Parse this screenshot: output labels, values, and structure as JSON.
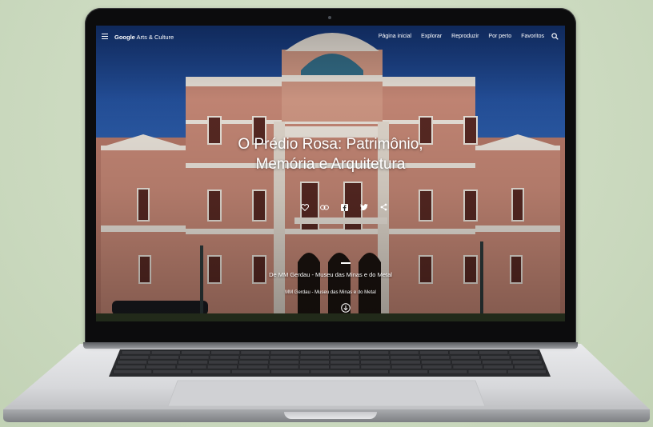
{
  "nav": {
    "brand_bold": "Google",
    "brand_rest": " Arts & Culture",
    "links": [
      "Página inicial",
      "Explorar",
      "Reproduzir",
      "Por perto",
      "Favoritos"
    ]
  },
  "hero": {
    "title_line1": "O Prédio Rosa: Patrimônio,",
    "title_line2": "Memória e Arquitetura",
    "byline": "De MM Gerdau - Museu das Minas e do Metal",
    "byline2": "MM Gerdau - Museu das Minas e do Metal"
  },
  "icons": {
    "menu": "menu-icon",
    "search": "search-icon",
    "share": [
      "heart-icon",
      "link-icon",
      "facebook-icon",
      "twitter-icon",
      "share-icon"
    ],
    "scroll": "chevron-down-circle-icon"
  },
  "colors": {
    "sky": "#2a5aa8",
    "facade": "#c98a78",
    "trim": "#efe8df",
    "backdrop": "#cfdcc4",
    "laptop_body": "#d9dadc"
  }
}
